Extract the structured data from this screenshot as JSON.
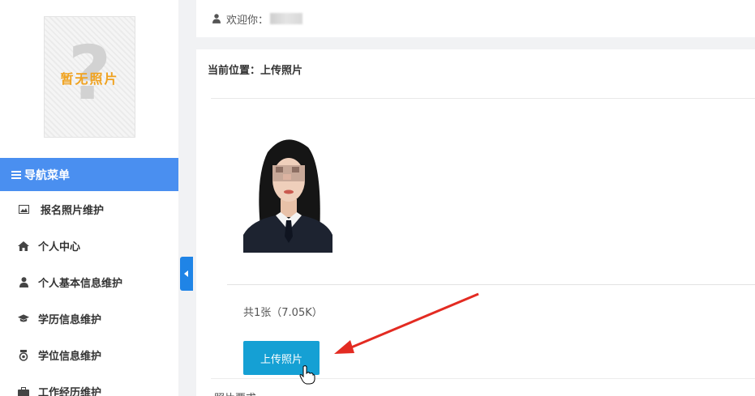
{
  "sidebar": {
    "avatar": {
      "placeholder_text": "暂无照片"
    },
    "nav_header": "导航菜单",
    "items": [
      {
        "label": "报名照片维护",
        "icon": "image-icon"
      },
      {
        "label": "个人中心",
        "icon": "home-icon"
      },
      {
        "label": "个人基本信息维护",
        "icon": "user-icon"
      },
      {
        "label": "学历信息维护",
        "icon": "graduation-cap-icon"
      },
      {
        "label": "学位信息维护",
        "icon": "medal-icon"
      },
      {
        "label": "工作经历维护",
        "icon": "briefcase-icon"
      }
    ]
  },
  "topbar": {
    "welcome": "欢迎你："
  },
  "main": {
    "breadcrumb": "当前位置：上传照片",
    "photo_count": "共1张（7.05K）",
    "upload_label": "上传照片",
    "cut_text": "照片要求"
  },
  "colors": {
    "nav_header_bg": "#4a8ff0",
    "upload_button_bg": "#15a0d4",
    "annotation_arrow": "#e32b22"
  }
}
